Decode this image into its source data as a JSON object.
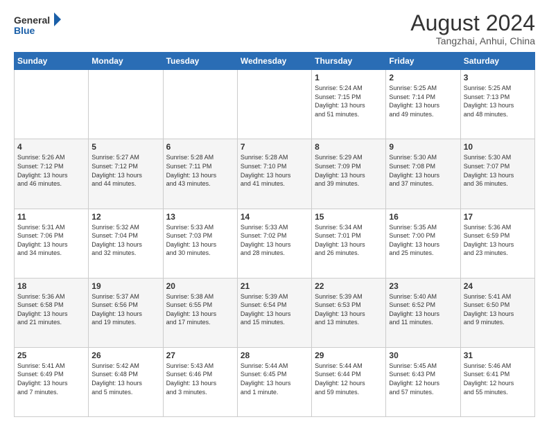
{
  "header": {
    "logo_line1": "General",
    "logo_line2": "Blue",
    "month_year": "August 2024",
    "location": "Tangzhai, Anhui, China"
  },
  "weekdays": [
    "Sunday",
    "Monday",
    "Tuesday",
    "Wednesday",
    "Thursday",
    "Friday",
    "Saturday"
  ],
  "weeks": [
    [
      {
        "day": "",
        "info": ""
      },
      {
        "day": "",
        "info": ""
      },
      {
        "day": "",
        "info": ""
      },
      {
        "day": "",
        "info": ""
      },
      {
        "day": "1",
        "info": "Sunrise: 5:24 AM\nSunset: 7:15 PM\nDaylight: 13 hours\nand 51 minutes."
      },
      {
        "day": "2",
        "info": "Sunrise: 5:25 AM\nSunset: 7:14 PM\nDaylight: 13 hours\nand 49 minutes."
      },
      {
        "day": "3",
        "info": "Sunrise: 5:25 AM\nSunset: 7:13 PM\nDaylight: 13 hours\nand 48 minutes."
      }
    ],
    [
      {
        "day": "4",
        "info": "Sunrise: 5:26 AM\nSunset: 7:12 PM\nDaylight: 13 hours\nand 46 minutes."
      },
      {
        "day": "5",
        "info": "Sunrise: 5:27 AM\nSunset: 7:12 PM\nDaylight: 13 hours\nand 44 minutes."
      },
      {
        "day": "6",
        "info": "Sunrise: 5:28 AM\nSunset: 7:11 PM\nDaylight: 13 hours\nand 43 minutes."
      },
      {
        "day": "7",
        "info": "Sunrise: 5:28 AM\nSunset: 7:10 PM\nDaylight: 13 hours\nand 41 minutes."
      },
      {
        "day": "8",
        "info": "Sunrise: 5:29 AM\nSunset: 7:09 PM\nDaylight: 13 hours\nand 39 minutes."
      },
      {
        "day": "9",
        "info": "Sunrise: 5:30 AM\nSunset: 7:08 PM\nDaylight: 13 hours\nand 37 minutes."
      },
      {
        "day": "10",
        "info": "Sunrise: 5:30 AM\nSunset: 7:07 PM\nDaylight: 13 hours\nand 36 minutes."
      }
    ],
    [
      {
        "day": "11",
        "info": "Sunrise: 5:31 AM\nSunset: 7:06 PM\nDaylight: 13 hours\nand 34 minutes."
      },
      {
        "day": "12",
        "info": "Sunrise: 5:32 AM\nSunset: 7:04 PM\nDaylight: 13 hours\nand 32 minutes."
      },
      {
        "day": "13",
        "info": "Sunrise: 5:33 AM\nSunset: 7:03 PM\nDaylight: 13 hours\nand 30 minutes."
      },
      {
        "day": "14",
        "info": "Sunrise: 5:33 AM\nSunset: 7:02 PM\nDaylight: 13 hours\nand 28 minutes."
      },
      {
        "day": "15",
        "info": "Sunrise: 5:34 AM\nSunset: 7:01 PM\nDaylight: 13 hours\nand 26 minutes."
      },
      {
        "day": "16",
        "info": "Sunrise: 5:35 AM\nSunset: 7:00 PM\nDaylight: 13 hours\nand 25 minutes."
      },
      {
        "day": "17",
        "info": "Sunrise: 5:36 AM\nSunset: 6:59 PM\nDaylight: 13 hours\nand 23 minutes."
      }
    ],
    [
      {
        "day": "18",
        "info": "Sunrise: 5:36 AM\nSunset: 6:58 PM\nDaylight: 13 hours\nand 21 minutes."
      },
      {
        "day": "19",
        "info": "Sunrise: 5:37 AM\nSunset: 6:56 PM\nDaylight: 13 hours\nand 19 minutes."
      },
      {
        "day": "20",
        "info": "Sunrise: 5:38 AM\nSunset: 6:55 PM\nDaylight: 13 hours\nand 17 minutes."
      },
      {
        "day": "21",
        "info": "Sunrise: 5:39 AM\nSunset: 6:54 PM\nDaylight: 13 hours\nand 15 minutes."
      },
      {
        "day": "22",
        "info": "Sunrise: 5:39 AM\nSunset: 6:53 PM\nDaylight: 13 hours\nand 13 minutes."
      },
      {
        "day": "23",
        "info": "Sunrise: 5:40 AM\nSunset: 6:52 PM\nDaylight: 13 hours\nand 11 minutes."
      },
      {
        "day": "24",
        "info": "Sunrise: 5:41 AM\nSunset: 6:50 PM\nDaylight: 13 hours\nand 9 minutes."
      }
    ],
    [
      {
        "day": "25",
        "info": "Sunrise: 5:41 AM\nSunset: 6:49 PM\nDaylight: 13 hours\nand 7 minutes."
      },
      {
        "day": "26",
        "info": "Sunrise: 5:42 AM\nSunset: 6:48 PM\nDaylight: 13 hours\nand 5 minutes."
      },
      {
        "day": "27",
        "info": "Sunrise: 5:43 AM\nSunset: 6:46 PM\nDaylight: 13 hours\nand 3 minutes."
      },
      {
        "day": "28",
        "info": "Sunrise: 5:44 AM\nSunset: 6:45 PM\nDaylight: 13 hours\nand 1 minute."
      },
      {
        "day": "29",
        "info": "Sunrise: 5:44 AM\nSunset: 6:44 PM\nDaylight: 12 hours\nand 59 minutes."
      },
      {
        "day": "30",
        "info": "Sunrise: 5:45 AM\nSunset: 6:43 PM\nDaylight: 12 hours\nand 57 minutes."
      },
      {
        "day": "31",
        "info": "Sunrise: 5:46 AM\nSunset: 6:41 PM\nDaylight: 12 hours\nand 55 minutes."
      }
    ]
  ]
}
